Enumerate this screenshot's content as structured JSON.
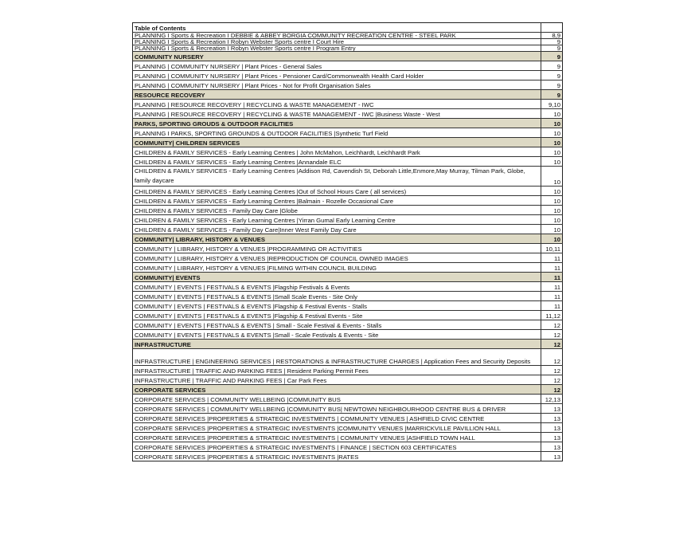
{
  "toc": {
    "title": "Table of Contents",
    "rows": [
      {
        "type": "item",
        "tight": true,
        "text": "PLANNING I Sports & Recreation I DEBBIE & ABBEY BORGIA COMMUNITY RECREATION CENTRE - STEEL PARK",
        "page": "8,9"
      },
      {
        "type": "item",
        "tight": true,
        "text": "PLANNING I Sports & Recreation I  Robyn Webster Sports centre I Court Hire",
        "page": "9"
      },
      {
        "type": "item",
        "tight": true,
        "text": "PLANNING I Sports & Recreation I  Robyn Webster Sports centre I Program Entry",
        "page": "9"
      },
      {
        "type": "section",
        "text": "COMMUNITY NURSERY",
        "page": "9"
      },
      {
        "type": "item",
        "text": "PLANNING  |  COMMUNITY NURSERY  |  Plant Prices - General Sales",
        "page": "9"
      },
      {
        "type": "item",
        "text": "PLANNING  |  COMMUNITY NURSERY  |  Plant Prices - Pensioner Card/Commonwealth Health Card Holder",
        "page": "9"
      },
      {
        "type": "item",
        "text": "PLANNING  |  COMMUNITY NURSERY  |  Plant Prices - Not for Profit Organisation Sales",
        "page": "9"
      },
      {
        "type": "section",
        "text": "RESOURCE RECOVERY",
        "page": "9"
      },
      {
        "type": "item",
        "text": "PLANNING  |  RESOURCE RECOVERY  |  RECYCLING & WASTE MANAGEMENT - IWC",
        "page": "9,10"
      },
      {
        "type": "item",
        "text": "PLANNING  |  RESOURCE RECOVERY  |  RECYCLING & WASTE MANAGEMENT - IWC |Business Waste - West",
        "page": "10"
      },
      {
        "type": "section",
        "text": "PARKS, SPORTING GROUDS & OUTDOOR FACILITIES",
        "page": "10"
      },
      {
        "type": "item",
        "text": "PLANNING I PARKS, SPORTING GROUNDS & OUTDOOR FACILITIES |Synthetic Turf Field",
        "page": "10"
      },
      {
        "type": "section",
        "text": "COMMUNITY| CHILDREN SERVICES",
        "page": "10"
      },
      {
        "type": "item",
        "text": "CHILDREN & FAMILY SERVICES - Early Learning Centres  |  John McMahon, Leichhardt, Leichhardt Park",
        "page": "10"
      },
      {
        "type": "item",
        "text": "CHILDREN & FAMILY SERVICES - Early Learning Centres  |Annandale ELC",
        "page": "10"
      },
      {
        "type": "item",
        "wrap": true,
        "text": "CHILDREN & FAMILY SERVICES - Early Learning Centres  |Addison Rd, Cavendish St, Deborah Little,Enmore,May Murray, Tilman Park, Globe, family daycare",
        "page": "10"
      },
      {
        "type": "item",
        "text": "CHILDREN & FAMILY SERVICES - Early Learning Centres  |Out of School Hours Care ( all services)",
        "page": "10"
      },
      {
        "type": "item",
        "text": "CHILDREN & FAMILY SERVICES - Early Learning Centres  |Balmain - Rozelle Occasional Care",
        "page": "10"
      },
      {
        "type": "item",
        "text": "CHILDREN & FAMILY SERVICES - Family Day Care  |Globe",
        "page": "10"
      },
      {
        "type": "item",
        "text": "CHILDREN & FAMILY SERVICES - Early Learning Centres  |Yirran Gumal Early Learning Centre",
        "page": "10"
      },
      {
        "type": "item",
        "text": "CHILDREN & FAMILY SERVICES - Family Day Care|Inner West Family Day Care",
        "page": "10"
      },
      {
        "type": "section",
        "text": "COMMUNITY| LIBRARY, HISTORY & VENUES",
        "page": "10"
      },
      {
        "type": "item",
        "text": "COMMUNITY  |  LIBRARY, HISTORY & VENUES  |PROGRAMMING OR ACTIVITIES",
        "page": "10,11"
      },
      {
        "type": "item",
        "text": "COMMUNITY  |  LIBRARY, HISTORY & VENUES  |REPRODUCTION OF COUNCIL OWNED IMAGES",
        "page": "11"
      },
      {
        "type": "item",
        "text": "COMMUNITY  |  LIBRARY, HISTORY & VENUES  |FILMING WITHIN COUNCIL BUILDING",
        "page": "11"
      },
      {
        "type": "section",
        "text": "COMMUNITY| EVENTS",
        "page": "11"
      },
      {
        "type": "item",
        "text": "COMMUNITY  |  EVENTS  |  FESTIVALS & EVENTS  |Flagship Festivals & Events",
        "page": "11"
      },
      {
        "type": "item",
        "text": "COMMUNITY  |  EVENTS  |  FESTIVALS & EVENTS  |Small Scale Events - Site Only",
        "page": "11"
      },
      {
        "type": "item",
        "text": "COMMUNITY  |  EVENTS  |  FESTIVALS & EVENTS  |Flagship & Festival Events - Stalls",
        "page": "11"
      },
      {
        "type": "item",
        "text": "COMMUNITY  |  EVENTS  |   FESTIVALS & EVENTS  |Flagship & Festival Events - Site",
        "page": "11,12"
      },
      {
        "type": "item",
        "text": "COMMUNITY  |  EVENTS  |  FESTIVALS & EVENTS  |  Small - Scale Festival & Events - Stalls",
        "page": "12"
      },
      {
        "type": "item",
        "text": "COMMUNITY  |  EVENTS  |  FESTIVALS & EVENTS  |Small - Scale Festivals & Events - Site",
        "page": "12"
      },
      {
        "type": "section",
        "text": "INFRASTRUCTURE",
        "page": "12"
      },
      {
        "type": "item",
        "tall": true,
        "text": "INFRASTRUCTURE  |  ENGINEERING SERVICES  |  RESTORATIONS & INFRASTRUCTURE CHARGES  |  Application Fees and Security Deposits",
        "page": "12"
      },
      {
        "type": "item",
        "text": "INFRASTRUCTURE  |  TRAFFIC AND PARKING FEES  |  Resident Parking Permit Fees",
        "page": "12"
      },
      {
        "type": "item",
        "text": "INFRASTRUCTURE  |  TRAFFIC AND PARKING FEES  |  Car Park Fees",
        "page": "12"
      },
      {
        "type": "section",
        "text": "CORPORATE SERVICES",
        "page": "12"
      },
      {
        "type": "item",
        "text": "CORPORATE SERVICES  |  COMMUNITY WELLBEING  |COMMUNITY BUS",
        "page": "12,13"
      },
      {
        "type": "item",
        "text": "CORPORATE SERVICES  |  COMMUNITY WELLBEING  |COMMUNITY BUS|  NEWTOWN NEIGHBOURHOOD CENTRE BUS & DRIVER",
        "page": "13"
      },
      {
        "type": "item",
        "text": "CORPORATE SERVICES  |PROPERTIES & STRATEGIC INVESTMENTS  |  COMMUNITY VENUES  |  ASHFIELD CIVIC CENTRE",
        "page": "13"
      },
      {
        "type": "item",
        "text": "CORPORATE SERVICES  |PROPERTIES & STRATEGIC INVESTMENTS  |COMMUNITY VENUES  |MARRICKVILLE PAVILLION HALL",
        "page": "13"
      },
      {
        "type": "item",
        "text": "CORPORATE SERVICES  |PROPERTIES & STRATEGIC INVESTMENTS  |  COMMUNITY VENUES  |ASHFIELD TOWN HALL",
        "page": "13"
      },
      {
        "type": "item",
        "text": "CORPORATE SERVICES  |PROPERTIES & STRATEGIC INVESTMENTS  |  FINANCE  |  SECTION 603 CERTIFICATES",
        "page": "13"
      },
      {
        "type": "item",
        "text": "CORPORATE SERVICES  |PROPERTIES & STRATEGIC INVESTMENTS  |RATES",
        "page": "13"
      }
    ]
  }
}
